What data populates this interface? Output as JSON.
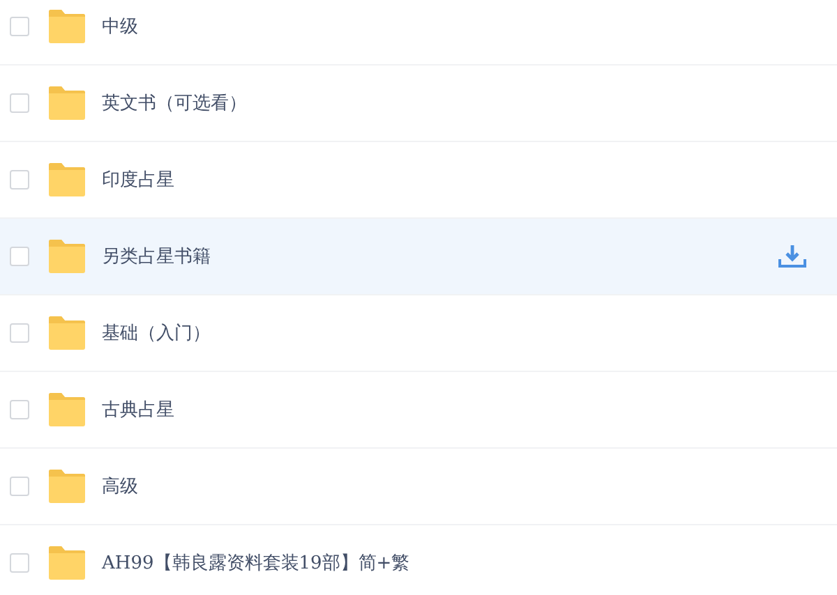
{
  "files": [
    {
      "name": "中级",
      "checked": false,
      "highlighted": false
    },
    {
      "name": "英文书（可选看）",
      "checked": false,
      "highlighted": false
    },
    {
      "name": "印度占星",
      "checked": false,
      "highlighted": false
    },
    {
      "name": "另类占星书籍",
      "checked": false,
      "highlighted": true
    },
    {
      "name": "基础（入门）",
      "checked": false,
      "highlighted": false
    },
    {
      "name": "古典占星",
      "checked": false,
      "highlighted": false
    },
    {
      "name": "高级",
      "checked": false,
      "highlighted": false
    },
    {
      "name": "AH99【韩良露资料套装19部】简+繁",
      "checked": false,
      "highlighted": false
    }
  ]
}
